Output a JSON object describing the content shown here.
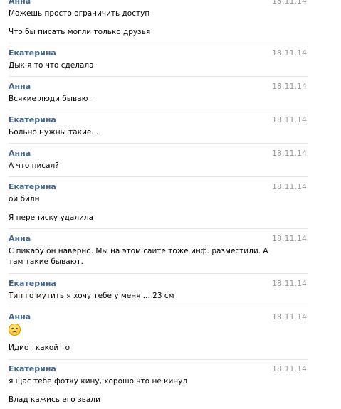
{
  "messages": [
    {
      "sender": "Анна",
      "date": "18.11.14",
      "lines": [
        "Можешь просто ограничить доступ",
        "Что бы писать могли только друзья"
      ]
    },
    {
      "sender": "Екатерина",
      "date": "18.11.14",
      "lines": [
        "Дык я то что сделала"
      ]
    },
    {
      "sender": "Анна",
      "date": "18.11.14",
      "lines": [
        "Всякие люди бывают"
      ]
    },
    {
      "sender": "Екатерина",
      "date": "18.11.14",
      "lines": [
        "Больно нужны такие..."
      ]
    },
    {
      "sender": "Анна",
      "date": "18.11.14",
      "lines": [
        "А что писал?"
      ]
    },
    {
      "sender": "Екатерина",
      "date": "18.11.14",
      "lines": [
        "ой билн",
        "Я переписку удалила"
      ]
    },
    {
      "sender": "Анна",
      "date": "18.11.14",
      "lines": [
        "С пикабу он наверно. Мы на этом сайте тоже инф. разместили. А там такие бывают."
      ]
    },
    {
      "sender": "Екатерина",
      "date": "18.11.14",
      "lines": [
        "Тип го мутить я хочу тебе у меня ... 23 см"
      ]
    },
    {
      "sender": "Анна",
      "date": "18.11.14",
      "emoji": "disappointed-face-emoji",
      "lines": [
        "Идиот какой то"
      ]
    },
    {
      "sender": "Екатерина",
      "date": "18.11.14",
      "lines": [
        "я щас тебе фотку кину, хорошо что не кинул",
        "Влад кажись его звали"
      ]
    }
  ]
}
